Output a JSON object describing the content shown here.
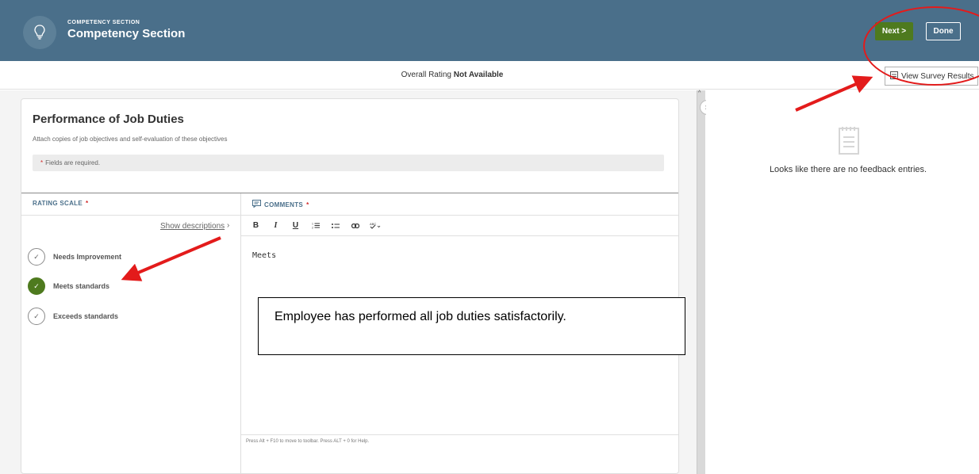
{
  "header": {
    "subtitle": "COMPETENCY SECTION",
    "title": "Competency Section",
    "next_label": "Next >",
    "done_label": "Done"
  },
  "subbar": {
    "overall_prefix": "Overall Rating",
    "overall_value": "Not Available",
    "survey_button": "View Survey Results"
  },
  "section": {
    "title": "Performance of Job Duties",
    "description": "Attach copies of job objectives and self-evaluation of these objectives",
    "required_note": "Fields are required."
  },
  "rating_scale": {
    "header": "RATING SCALE",
    "show_descriptions": "Show descriptions",
    "options": [
      {
        "label": "Needs Improvement",
        "selected": false
      },
      {
        "label": "Meets standards",
        "selected": true
      },
      {
        "label": "Exceeds standards",
        "selected": false
      }
    ]
  },
  "comments": {
    "header": "COMMENTS",
    "toolbar": [
      "B",
      "I",
      "U",
      "ordered-list",
      "bulleted-list",
      "link",
      "spellcheck"
    ],
    "text": "Meets",
    "footer_hint": "Press Alt + F10 to move to toolbar. Press ALT + 0 for Help."
  },
  "callout": {
    "text": "Employee has performed all job duties satisfactorily."
  },
  "feedback_panel": {
    "empty_text": "Looks like there are no feedback entries."
  },
  "colors": {
    "header_bg": "#4a6f8a",
    "accent_green": "#4e7a1e",
    "required_red": "#d12a2a",
    "annotation_red": "#e31b1b"
  }
}
